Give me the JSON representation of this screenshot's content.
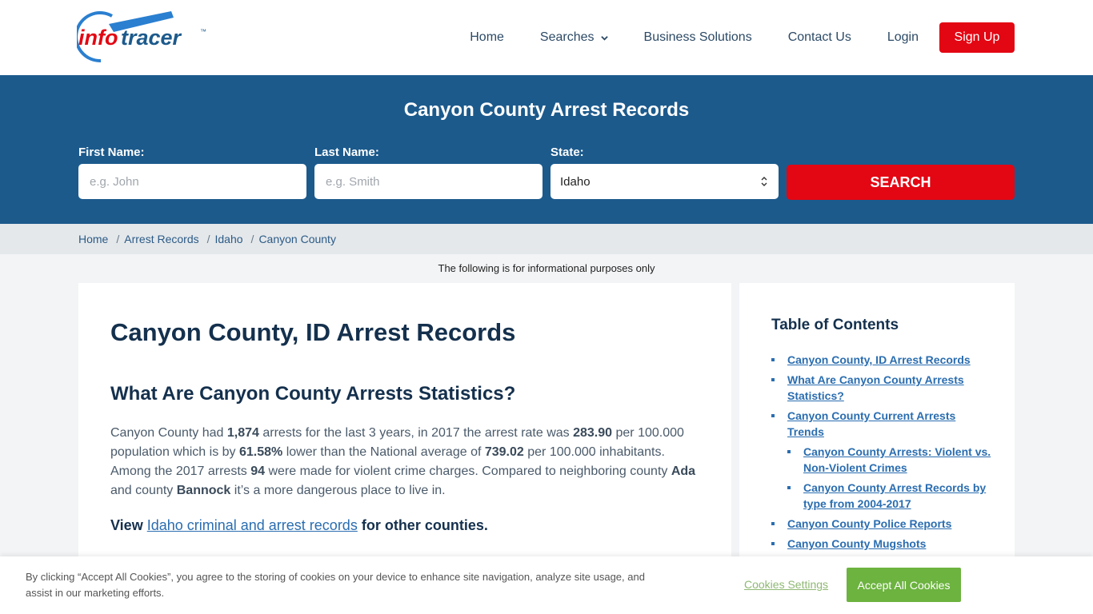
{
  "brand": {
    "part1": "info",
    "part2": "tracer",
    "tm": "™",
    "red": "#e30613",
    "blue": "#1c5a8c"
  },
  "nav": {
    "items": [
      {
        "label": "Home"
      },
      {
        "label": "Searches"
      },
      {
        "label": "Business Solutions"
      },
      {
        "label": "Contact Us"
      },
      {
        "label": "Login"
      }
    ],
    "signup": "Sign Up"
  },
  "hero": {
    "title": "Canyon County Arrest Records",
    "first_name": {
      "label": "First Name:",
      "placeholder": "e.g. John",
      "value": ""
    },
    "last_name": {
      "label": "Last Name:",
      "placeholder": "e.g. Smith",
      "value": ""
    },
    "state": {
      "label": "State:",
      "value": "Idaho"
    },
    "search": "SEARCH"
  },
  "breadcrumb": [
    "Home",
    "Arrest Records",
    "Idaho",
    "Canyon County"
  ],
  "notice": "The following is for informational purposes only",
  "article": {
    "h1": "Canyon County, ID Arrest Records",
    "h2": "What Are Canyon County Arrests Statistics?",
    "p": {
      "t1": "Canyon County had ",
      "arrests": "1,874",
      "t2": " arrests for the last 3 years, in 2017 the arrest rate was ",
      "rate": "283.90",
      "t3": " per 100.000 population which is by ",
      "pct": "61.58%",
      "t4": " lower than the National average of ",
      "national": "739.02",
      "t5": " per 100.000 inhabitants. Among the 2017 arrests ",
      "violent": "94",
      "t6": " were made for violent crime charges. Compared to neighboring county ",
      "county1": "Ada",
      "t7": " and county ",
      "county2": "Bannock",
      "t8": " it’s a more dangerous place to live in."
    },
    "view": {
      "pre": "View ",
      "link": "Idaho criminal and arrest records",
      "post": " for other counties."
    }
  },
  "toc": {
    "title": "Table of Contents",
    "items": [
      "Canyon County, ID Arrest Records",
      "What Are Canyon County Arrests Statistics?",
      "Canyon County Current Arrests Trends",
      "Canyon County Arrests: Violent vs. Non-Violent Crimes",
      "Canyon County Arrest Records by type from 2004-2017",
      "Canyon County Police Reports",
      "Canyon County Mugshots"
    ]
  },
  "cookie": {
    "text": "By clicking “Accept All Cookies”, you agree to the storing of cookies on your device to enhance site navigation, analyze site usage, and assist in our marketing efforts.",
    "settings": "Cookies Settings",
    "accept": "Accept All Cookies"
  }
}
